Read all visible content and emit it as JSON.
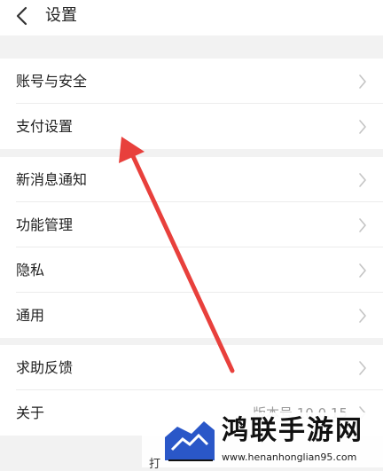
{
  "header": {
    "title": "设置",
    "back_icon": "chevron-left-icon"
  },
  "groups": [
    {
      "items": [
        {
          "label": "账号与安全",
          "icon": "chevron-right-icon"
        },
        {
          "label": "支付设置",
          "icon": "chevron-right-icon"
        }
      ]
    },
    {
      "items": [
        {
          "label": "新消息通知",
          "icon": "chevron-right-icon"
        },
        {
          "label": "功能管理",
          "icon": "chevron-right-icon"
        },
        {
          "label": "隐私",
          "icon": "chevron-right-icon"
        },
        {
          "label": "通用",
          "icon": "chevron-right-icon"
        }
      ]
    },
    {
      "items": [
        {
          "label": "求助反馈",
          "icon": "chevron-right-icon"
        },
        {
          "label": "关于",
          "value": "版本号 10.0.15",
          "icon": "chevron-right-icon"
        }
      ]
    }
  ],
  "annotation": {
    "color": "#e8403c",
    "icon": "red-arrow-pointer"
  },
  "watermark": {
    "title": "鸿联手游网",
    "url": "www.henanhonglian95.com",
    "colors": {
      "blue": "#2a57c8",
      "dark": "#111111"
    }
  },
  "bottom_fragment": "打"
}
